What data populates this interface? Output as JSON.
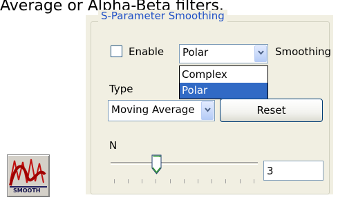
{
  "intro_text": "Average or Alpha-Beta filters.",
  "group": {
    "title": "S-Parameter Smoothing"
  },
  "enable": {
    "label": "Enable",
    "checked": false
  },
  "mode": {
    "value": "Polar",
    "suffix": "Smoothing",
    "options": [
      "Complex",
      "Polar"
    ],
    "selected": "Polar"
  },
  "type": {
    "label": "Type",
    "value": "Moving Average"
  },
  "reset_label": "Reset",
  "n": {
    "label": "N",
    "value": "3",
    "slider_position": 0.3
  },
  "smooth_icon": {
    "name": "smooth-icon",
    "caption": "SMOOTH"
  },
  "colors": {
    "legend": "#1f50c6",
    "highlight": "#316ac5",
    "panel": "#f1efe2"
  }
}
